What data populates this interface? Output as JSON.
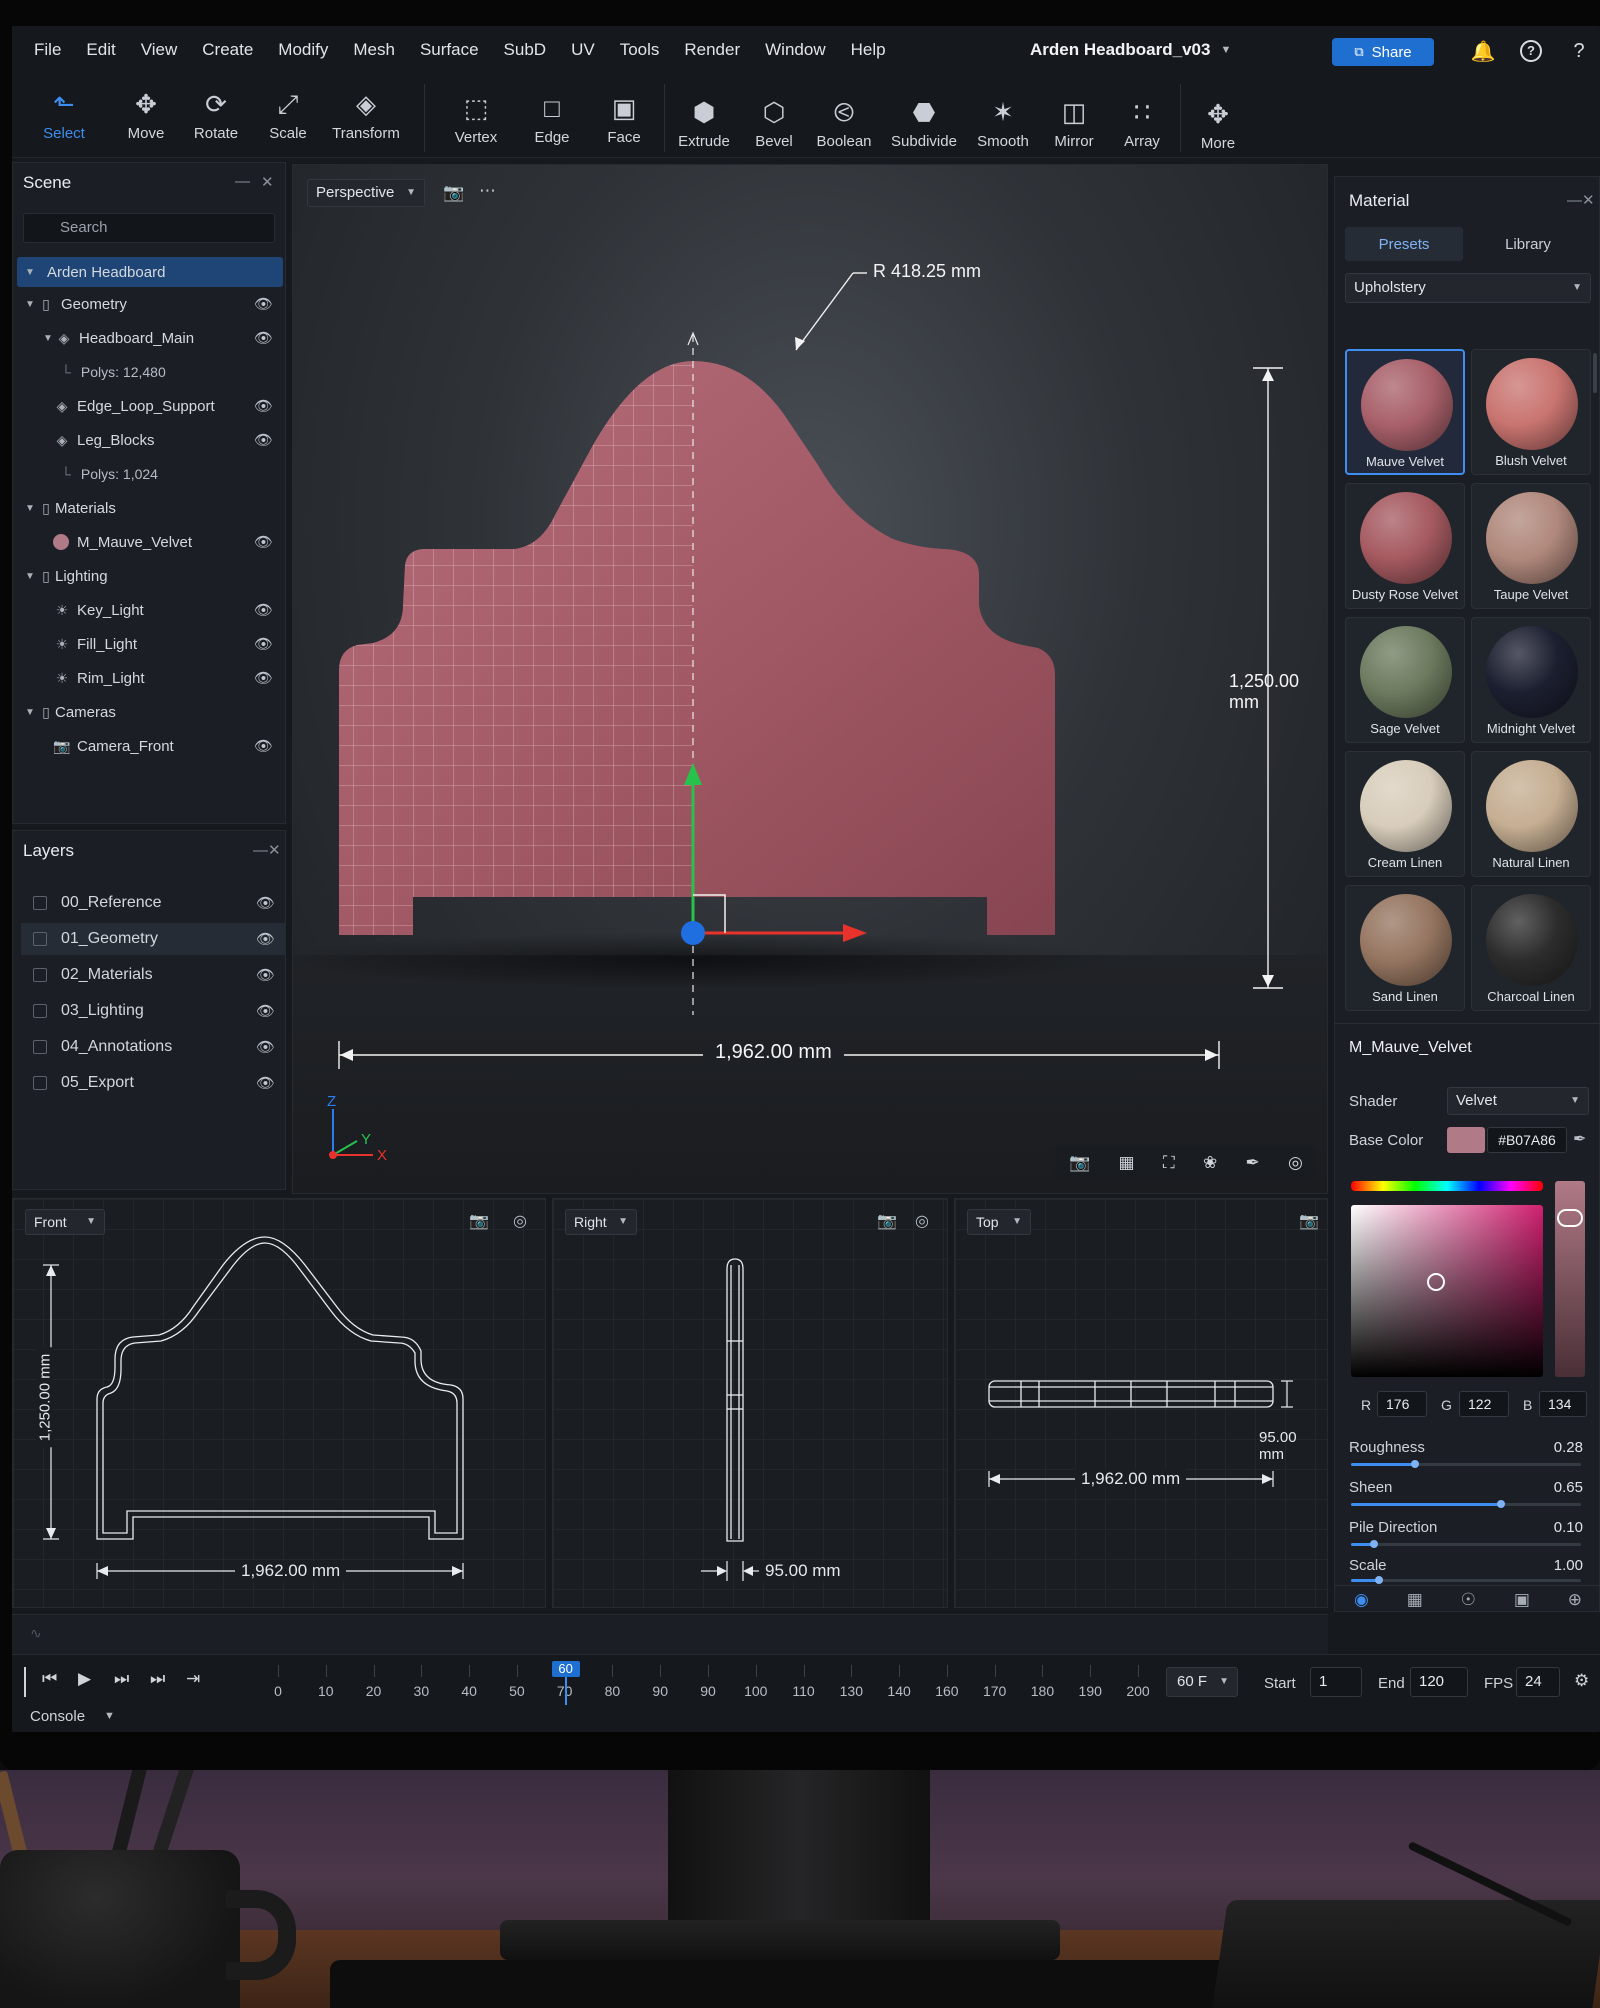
{
  "menu": [
    "File",
    "Edit",
    "View",
    "Create",
    "Modify",
    "Mesh",
    "Surface",
    "SubD",
    "UV",
    "Tools",
    "Render",
    "Window",
    "Help"
  ],
  "project_title": "Arden Headboard_v03",
  "share_label": "Share",
  "toolbar": {
    "tools": [
      "Select",
      "Move",
      "Rotate",
      "Scale",
      "Transform"
    ],
    "components": [
      "Vertex",
      "Edge",
      "Face"
    ],
    "ops": [
      "Extrude",
      "Bevel",
      "Boolean",
      "Subdivide",
      "Smooth",
      "Mirror",
      "Array",
      "More"
    ]
  },
  "scene": {
    "title": "Scene",
    "search_placeholder": "Search",
    "root": "Arden Headboard",
    "groups": {
      "geometry": "Geometry",
      "materials": "Materials",
      "lighting": "Lighting",
      "cameras": "Cameras"
    },
    "items": {
      "headboard_main": "Headboard_Main",
      "headboard_polys": "Polys: 12,480",
      "edge_loop": "Edge_Loop_Support",
      "leg_blocks": "Leg_Blocks",
      "leg_polys": "Polys: 1,024",
      "material": "M_Mauve_Velvet",
      "key_light": "Key_Light",
      "fill_light": "Fill_Light",
      "rim_light": "Rim_Light",
      "camera_front": "Camera_Front"
    }
  },
  "layers": {
    "title": "Layers",
    "items": [
      "00_Reference",
      "01_Geometry",
      "02_Materials",
      "03_Lighting",
      "04_Annotations",
      "05_Export"
    ]
  },
  "viewport": {
    "mode": "Perspective",
    "radius_label": "R 418.25 mm",
    "height_label": "1,250.00 mm",
    "width_label": "1,962.00 mm",
    "axis_z": "Z",
    "axis_y": "Y",
    "axis_x": "X"
  },
  "ortho": {
    "front": {
      "mode": "Front",
      "height": "1,250.00 mm",
      "width": "1,962.00 mm"
    },
    "right": {
      "mode": "Right",
      "depth": "95.00 mm"
    },
    "top": {
      "mode": "Top",
      "depth": "95.00 mm",
      "width": "1,962.00 mm"
    }
  },
  "material_panel": {
    "title": "Material",
    "tabs": [
      "Presets",
      "Library"
    ],
    "category": "Upholstery",
    "presets": [
      {
        "name": "Mauve Velvet",
        "color": "#a8606a"
      },
      {
        "name": "Blush Velvet",
        "color": "#c97470"
      },
      {
        "name": "Dusty Rose Velvet",
        "color": "#a55a60"
      },
      {
        "name": "Taupe Velvet",
        "color": "#b0887c"
      },
      {
        "name": "Sage Velvet",
        "color": "#6c7a5e"
      },
      {
        "name": "Midnight Velvet",
        "color": "#1c1f30"
      },
      {
        "name": "Cream Linen",
        "color": "#d8cdbb"
      },
      {
        "name": "Natural Linen",
        "color": "#c5ae92"
      },
      {
        "name": "Sand Linen",
        "color": "#957560"
      },
      {
        "name": "Charcoal Linen",
        "color": "#2c2c2c"
      }
    ],
    "material_name": "M_Mauve_Velvet",
    "shader_label": "Shader",
    "shader": "Velvet",
    "base_color_label": "Base Color",
    "hex": "#B07A86",
    "rgb": {
      "r_label": "R",
      "r": "176",
      "g_label": "G",
      "g": "122",
      "b_label": "B",
      "b": "134"
    },
    "props": [
      {
        "label": "Roughness",
        "value": "0.28",
        "fraction": 0.28
      },
      {
        "label": "Sheen",
        "value": "0.65",
        "fraction": 0.65
      },
      {
        "label": "Pile Direction",
        "value": "0.10",
        "fraction": 0.1
      },
      {
        "label": "Scale",
        "value": "1.00",
        "fraction": 0.12
      }
    ]
  },
  "timeline": {
    "ticks": [
      "0",
      "10",
      "20",
      "30",
      "40",
      "50",
      "70",
      "80",
      "90",
      "90",
      "100",
      "110",
      "130",
      "140",
      "160",
      "170",
      "180",
      "190",
      "200"
    ],
    "current_frame": "60",
    "fps_select": "60 F",
    "start_label": "Start",
    "start": "1",
    "end_label": "End",
    "end": "120",
    "fps_label": "FPS",
    "fps": "24"
  },
  "console_label": "Console"
}
